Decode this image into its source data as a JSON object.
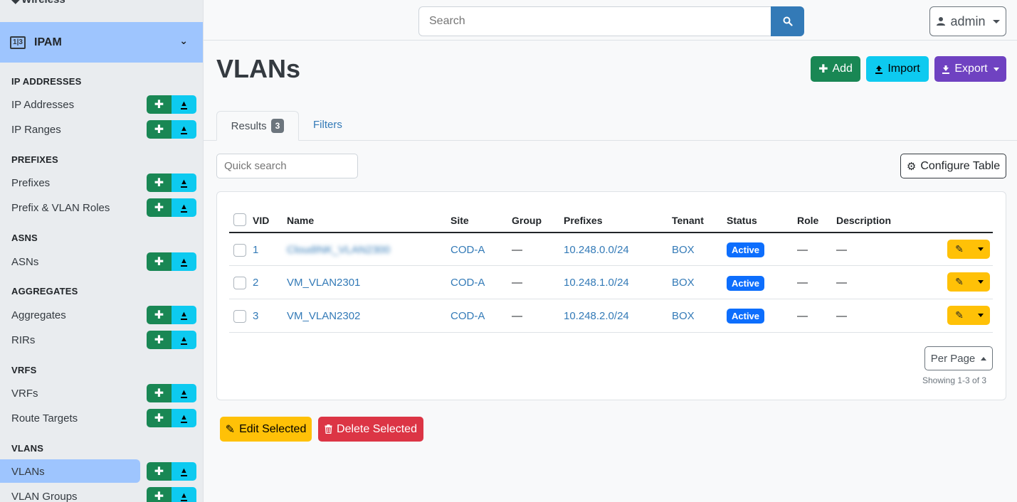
{
  "sidebar": {
    "partial_top": "Wireless",
    "group": {
      "label": "IPAM",
      "icon": "ipam-icon"
    },
    "sections": [
      {
        "label": "IP ADDRESSES",
        "items": [
          "IP Addresses",
          "IP Ranges"
        ]
      },
      {
        "label": "PREFIXES",
        "items": [
          "Prefixes",
          "Prefix & VLAN Roles"
        ]
      },
      {
        "label": "ASNS",
        "items": [
          "ASNs"
        ]
      },
      {
        "label": "AGGREGATES",
        "items": [
          "Aggregates",
          "RIRs"
        ]
      },
      {
        "label": "VRFS",
        "items": [
          "VRFs",
          "Route Targets"
        ]
      },
      {
        "label": "VLANS",
        "items": [
          "VLANs",
          "VLAN Groups"
        ]
      }
    ],
    "active_item": "VLANs"
  },
  "topbar": {
    "search_placeholder": "Search",
    "user": "admin"
  },
  "page": {
    "title": "VLANs",
    "buttons": {
      "add": "Add",
      "import": "Import",
      "export": "Export"
    }
  },
  "tabs": {
    "results": "Results",
    "results_count": "3",
    "filters": "Filters"
  },
  "toolbar": {
    "quick_search_placeholder": "Quick search",
    "configure_table": "Configure Table"
  },
  "table": {
    "headers": [
      "VID",
      "Name",
      "Site",
      "Group",
      "Prefixes",
      "Tenant",
      "Status",
      "Role",
      "Description"
    ],
    "rows": [
      {
        "vid": "1",
        "name": "CloudINK_VLAN2300",
        "site": "COD-A",
        "group": "—",
        "prefix": "10.248.0.0/24",
        "tenant": "BOX",
        "status": "Active",
        "role": "—",
        "description": "—"
      },
      {
        "vid": "2",
        "name": "VM_VLAN2301",
        "site": "COD-A",
        "group": "—",
        "prefix": "10.248.1.0/24",
        "tenant": "BOX",
        "status": "Active",
        "role": "—",
        "description": "—"
      },
      {
        "vid": "3",
        "name": "VM_VLAN2302",
        "site": "COD-A",
        "group": "—",
        "prefix": "10.248.2.0/24",
        "tenant": "BOX",
        "status": "Active",
        "role": "—",
        "description": "—"
      }
    ]
  },
  "pagination": {
    "per_page": "Per Page",
    "showing": "Showing 1-3 of 3"
  },
  "bulk": {
    "edit": "Edit Selected",
    "delete": "Delete Selected"
  },
  "colors": {
    "primary": "#337ab7",
    "success": "#198754",
    "info": "#0dcaf0",
    "purple": "#6f42c1",
    "warning": "#ffc107",
    "danger": "#dc3545",
    "active_bg": "#9ec5fe"
  }
}
